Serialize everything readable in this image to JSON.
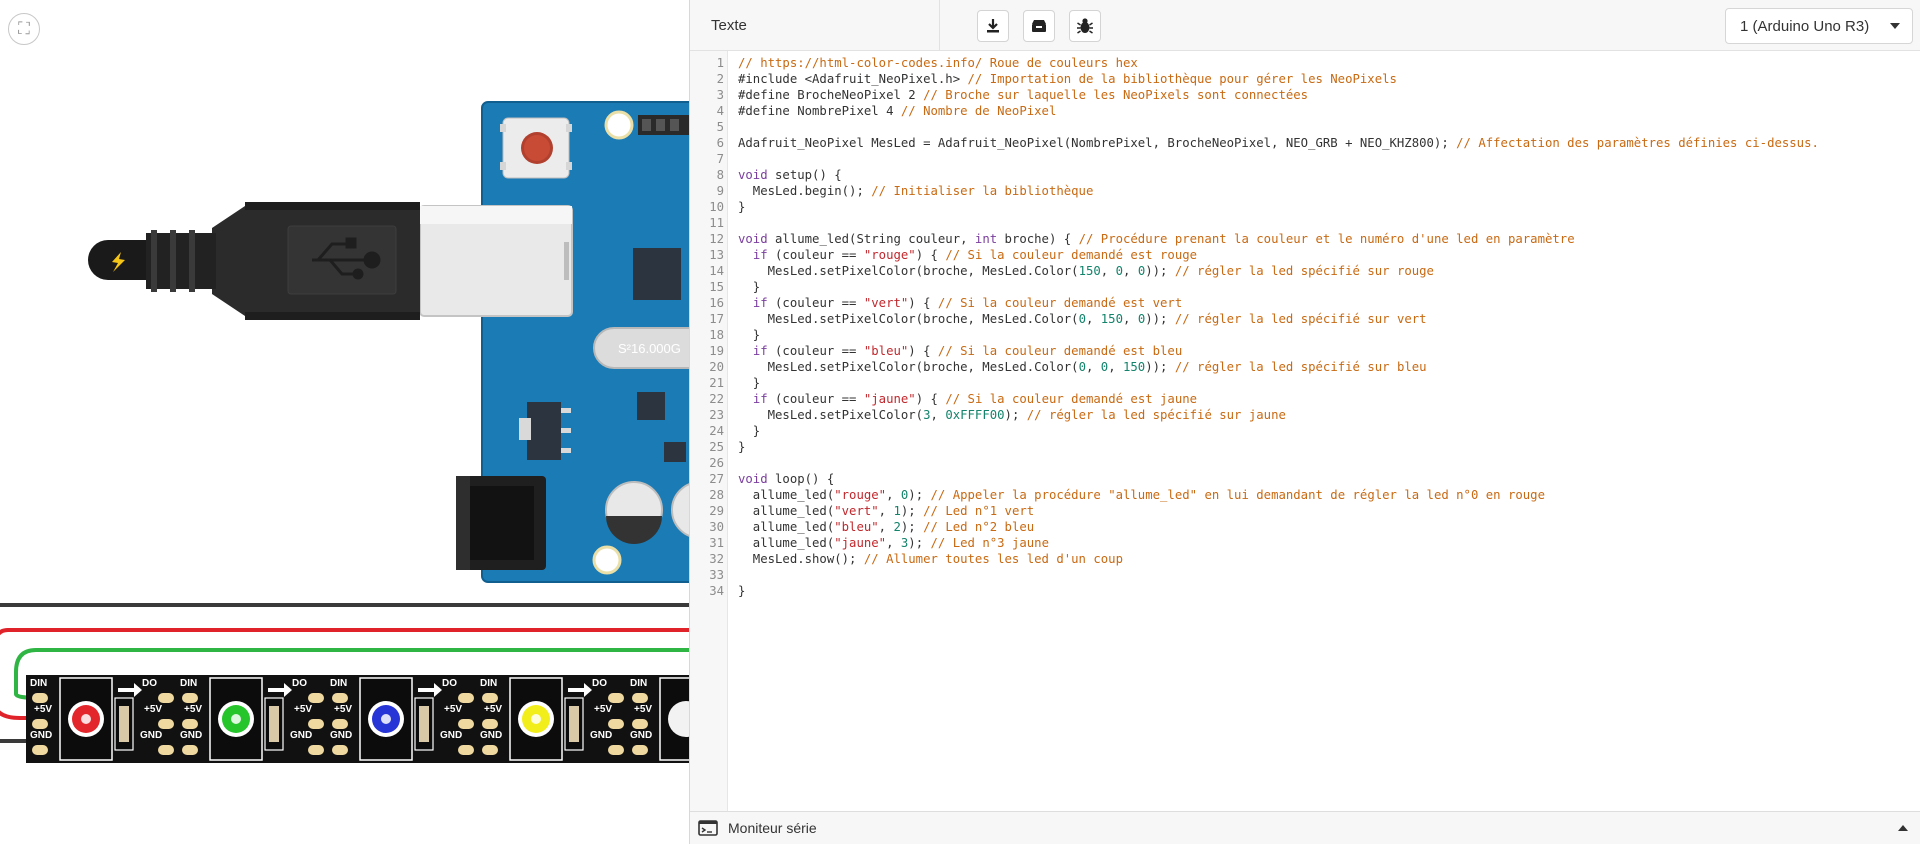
{
  "code_panel": {
    "mode_label": "Texte",
    "device_label": "1 (Arduino Uno R3)",
    "serial_monitor_label": "Moniteur série",
    "toolbar_icons": [
      "download-icon",
      "library-icon",
      "debug-bug-icon"
    ]
  },
  "canvas": {
    "usb_plug_icon": "lightning-icon",
    "crystal_label": "S²16.000G",
    "led_strip": {
      "pad_labels": {
        "din": "DIN",
        "do": "DO",
        "plus5v": "+5V",
        "gnd": "GND"
      },
      "led_colors": [
        "#e3262b",
        "#25c52b",
        "#2734d6",
        "#f2ee1b"
      ]
    }
  },
  "code_lines": [
    {
      "n": "1",
      "tokens": [
        [
          "c",
          "// https://html-color-codes.info/ Roue de couleurs hex"
        ]
      ]
    },
    {
      "n": "2",
      "tokens": [
        [
          "p",
          "#include <Adafruit_NeoPixel.h> "
        ],
        [
          "c",
          "// Importation de la bibliothèque pour gérer les NeoPixels"
        ]
      ]
    },
    {
      "n": "3",
      "tokens": [
        [
          "p",
          "#define BrocheNeoPixel 2 "
        ],
        [
          "c",
          "// Broche sur laquelle les NeoPixels sont connectées"
        ]
      ]
    },
    {
      "n": "4",
      "tokens": [
        [
          "p",
          "#define NombrePixel 4 "
        ],
        [
          "c",
          "// Nombre de NeoPixel"
        ]
      ]
    },
    {
      "n": "5",
      "tokens": []
    },
    {
      "n": "6",
      "tokens": [
        [
          "p",
          "Adafruit_NeoPixel MesLed = Adafruit_NeoPixel(NombrePixel, BrocheNeoPixel, NEO_GRB + NEO_KHZ800); "
        ],
        [
          "c",
          "// Affectation des paramètres définies ci-dessus."
        ]
      ]
    },
    {
      "n": "7",
      "tokens": []
    },
    {
      "n": "8",
      "tokens": [
        [
          "k",
          "void"
        ],
        [
          "p",
          " setup() {"
        ]
      ]
    },
    {
      "n": "9",
      "tokens": [
        [
          "p",
          "  MesLed.begin(); "
        ],
        [
          "c",
          "// Initialiser la bibliothèque"
        ]
      ]
    },
    {
      "n": "10",
      "tokens": [
        [
          "p",
          "}"
        ]
      ]
    },
    {
      "n": "11",
      "tokens": []
    },
    {
      "n": "12",
      "tokens": [
        [
          "k",
          "void"
        ],
        [
          "p",
          " allume_led(String couleur, "
        ],
        [
          "k",
          "int"
        ],
        [
          "p",
          " broche) { "
        ],
        [
          "c",
          "// Procédure prenant la couleur et le numéro d'une led en paramètre"
        ]
      ]
    },
    {
      "n": "13",
      "tokens": [
        [
          "p",
          "  "
        ],
        [
          "k",
          "if"
        ],
        [
          "p",
          " (couleur == "
        ],
        [
          "s",
          "\"rouge\""
        ],
        [
          "p",
          ") { "
        ],
        [
          "c",
          "// Si la couleur demandé est rouge"
        ]
      ]
    },
    {
      "n": "14",
      "tokens": [
        [
          "p",
          "    MesLed.setPixelColor(broche, MesLed.Color("
        ],
        [
          "n",
          "150"
        ],
        [
          "p",
          ", "
        ],
        [
          "n",
          "0"
        ],
        [
          "p",
          ", "
        ],
        [
          "n",
          "0"
        ],
        [
          "p",
          ")); "
        ],
        [
          "c",
          "// régler la led spécifié sur rouge"
        ]
      ]
    },
    {
      "n": "15",
      "tokens": [
        [
          "p",
          "  }"
        ]
      ]
    },
    {
      "n": "16",
      "tokens": [
        [
          "p",
          "  "
        ],
        [
          "k",
          "if"
        ],
        [
          "p",
          " (couleur == "
        ],
        [
          "s",
          "\"vert\""
        ],
        [
          "p",
          ") { "
        ],
        [
          "c",
          "// Si la couleur demandé est vert"
        ]
      ]
    },
    {
      "n": "17",
      "tokens": [
        [
          "p",
          "    MesLed.setPixelColor(broche, MesLed.Color("
        ],
        [
          "n",
          "0"
        ],
        [
          "p",
          ", "
        ],
        [
          "n",
          "150"
        ],
        [
          "p",
          ", "
        ],
        [
          "n",
          "0"
        ],
        [
          "p",
          ")); "
        ],
        [
          "c",
          "// régler la led spécifié sur vert"
        ]
      ]
    },
    {
      "n": "18",
      "tokens": [
        [
          "p",
          "  }"
        ]
      ]
    },
    {
      "n": "19",
      "tokens": [
        [
          "p",
          "  "
        ],
        [
          "k",
          "if"
        ],
        [
          "p",
          " (couleur == "
        ],
        [
          "s",
          "\"bleu\""
        ],
        [
          "p",
          ") { "
        ],
        [
          "c",
          "// Si la couleur demandé est bleu"
        ]
      ]
    },
    {
      "n": "20",
      "tokens": [
        [
          "p",
          "    MesLed.setPixelColor(broche, MesLed.Color("
        ],
        [
          "n",
          "0"
        ],
        [
          "p",
          ", "
        ],
        [
          "n",
          "0"
        ],
        [
          "p",
          ", "
        ],
        [
          "n",
          "150"
        ],
        [
          "p",
          ")); "
        ],
        [
          "c",
          "// régler la led spécifié sur bleu"
        ]
      ]
    },
    {
      "n": "21",
      "tokens": [
        [
          "p",
          "  }"
        ]
      ]
    },
    {
      "n": "22",
      "tokens": [
        [
          "p",
          "  "
        ],
        [
          "k",
          "if"
        ],
        [
          "p",
          " (couleur == "
        ],
        [
          "s",
          "\"jaune\""
        ],
        [
          "p",
          ") { "
        ],
        [
          "c",
          "// Si la couleur demandé est jaune"
        ]
      ]
    },
    {
      "n": "23",
      "tokens": [
        [
          "p",
          "    MesLed.setPixelColor("
        ],
        [
          "n",
          "3"
        ],
        [
          "p",
          ", "
        ],
        [
          "n",
          "0xFFFF00"
        ],
        [
          "p",
          "); "
        ],
        [
          "c",
          "// régler la led spécifié sur jaune"
        ]
      ]
    },
    {
      "n": "24",
      "tokens": [
        [
          "p",
          "  }"
        ]
      ]
    },
    {
      "n": "25",
      "tokens": [
        [
          "p",
          "}"
        ]
      ]
    },
    {
      "n": "26",
      "tokens": []
    },
    {
      "n": "27",
      "tokens": [
        [
          "k",
          "void"
        ],
        [
          "p",
          " loop() {"
        ]
      ]
    },
    {
      "n": "28",
      "tokens": [
        [
          "p",
          "  allume_led("
        ],
        [
          "s",
          "\"rouge\""
        ],
        [
          "p",
          ", "
        ],
        [
          "n",
          "0"
        ],
        [
          "p",
          "); "
        ],
        [
          "c",
          "// Appeler la procédure \"allume_led\" en lui demandant de régler la led n°0 en rouge"
        ]
      ]
    },
    {
      "n": "29",
      "tokens": [
        [
          "p",
          "  allume_led("
        ],
        [
          "s",
          "\"vert\""
        ],
        [
          "p",
          ", "
        ],
        [
          "n",
          "1"
        ],
        [
          "p",
          "); "
        ],
        [
          "c",
          "// Led n°1 vert"
        ]
      ]
    },
    {
      "n": "30",
      "tokens": [
        [
          "p",
          "  allume_led("
        ],
        [
          "s",
          "\"bleu\""
        ],
        [
          "p",
          ", "
        ],
        [
          "n",
          "2"
        ],
        [
          "p",
          "); "
        ],
        [
          "c",
          "// Led n°2 bleu"
        ]
      ]
    },
    {
      "n": "31",
      "tokens": [
        [
          "p",
          "  allume_led("
        ],
        [
          "s",
          "\"jaune\""
        ],
        [
          "p",
          ", "
        ],
        [
          "n",
          "3"
        ],
        [
          "p",
          "); "
        ],
        [
          "c",
          "// Led n°3 jaune"
        ]
      ]
    },
    {
      "n": "32",
      "tokens": [
        [
          "p",
          "  MesLed.show(); "
        ],
        [
          "c",
          "// Allumer toutes les led d'un coup"
        ]
      ]
    },
    {
      "n": "33",
      "tokens": []
    },
    {
      "n": "34",
      "tokens": [
        [
          "p",
          "}"
        ]
      ]
    }
  ]
}
